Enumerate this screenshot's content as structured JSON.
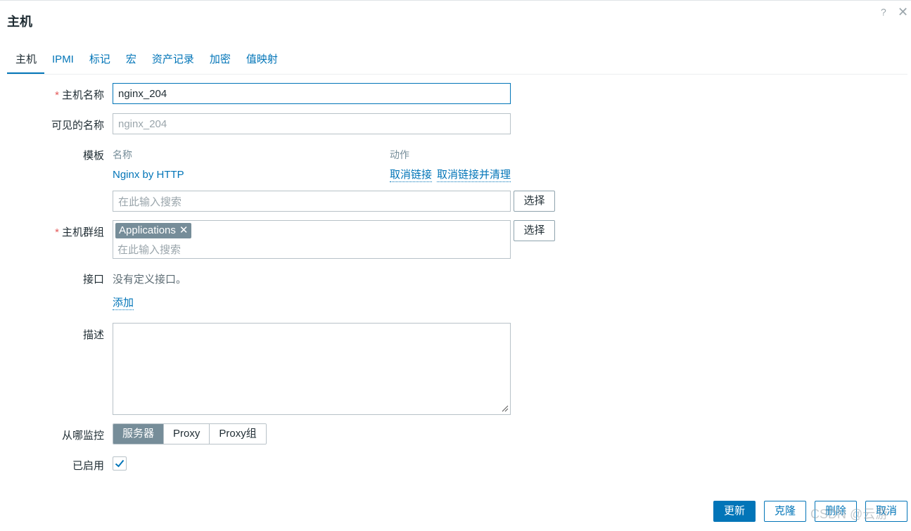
{
  "dialog": {
    "title": "主机",
    "help": "?",
    "close": "✕"
  },
  "tabs": [
    "主机",
    "IPMI",
    "标记",
    "宏",
    "资产记录",
    "加密",
    "值映射"
  ],
  "form": {
    "host_name": {
      "label": "主机名称",
      "required_mark": "*",
      "value": "nginx_204"
    },
    "visible_name": {
      "label": "可见的名称",
      "placeholder": "nginx_204"
    },
    "templates": {
      "label": "模板",
      "col_name": "名称",
      "col_action": "动作",
      "linked": [
        {
          "name": "Nginx by HTTP",
          "unlink": "取消链接",
          "unlink_clear": "取消链接并清理"
        }
      ],
      "search_placeholder": "在此输入搜索",
      "select_button": "选择"
    },
    "host_groups": {
      "label": "主机群组",
      "required_mark": "*",
      "chips": [
        "Applications"
      ],
      "chip_remove": "✕",
      "search_placeholder": "在此输入搜索",
      "select_button": "选择"
    },
    "interfaces": {
      "label": "接口",
      "empty_text": "没有定义接口。",
      "add_link": "添加"
    },
    "description": {
      "label": "描述",
      "value": ""
    },
    "monitored_by": {
      "label": "从哪监控",
      "options": [
        "服务器",
        "Proxy",
        "Proxy组"
      ],
      "selected": "服务器"
    },
    "enabled": {
      "label": "已启用",
      "checked": true
    }
  },
  "footer": {
    "update": "更新",
    "clone": "克隆",
    "delete": "删除",
    "cancel": "取消"
  },
  "watermark": "CSDN @云游",
  "colors": {
    "accent": "#0275b8",
    "chip": "#768d99",
    "required": "#e45959"
  }
}
